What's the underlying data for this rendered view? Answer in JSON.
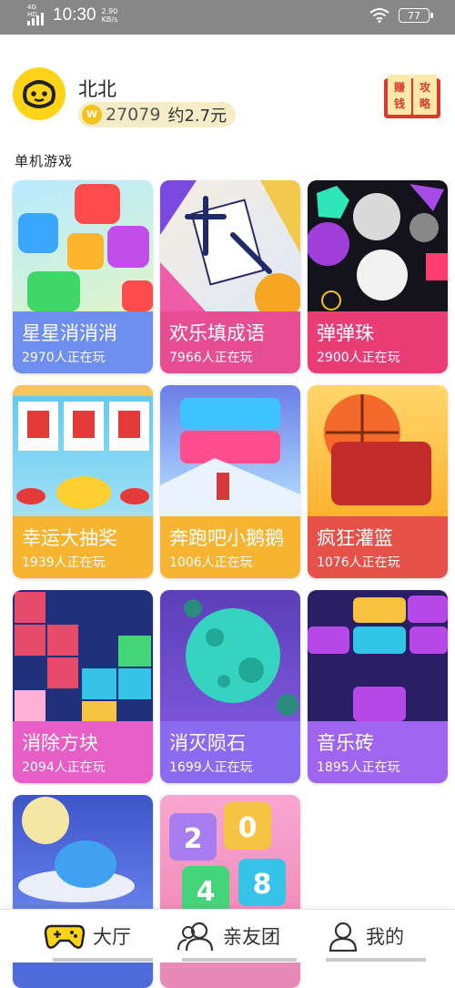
{
  "status_bar": {
    "network": "4G HD",
    "time": "10:30",
    "speed_value": "2.90",
    "speed_unit": "KB/s",
    "battery": "77"
  },
  "profile": {
    "name": "北北",
    "coins": "27079",
    "yuan_estimate": "约2.7元",
    "coin_icon_glyph": "W",
    "guide_button": [
      "赚",
      "钱",
      "攻",
      "略"
    ]
  },
  "section_title": "单机游戏",
  "games": [
    {
      "name": "星星消消消",
      "players": "2970人正在玩",
      "color": "#6e8ef0"
    },
    {
      "name": "欢乐填成语",
      "players": "7966人正在玩",
      "color": "#e64d93"
    },
    {
      "name": "弹弹珠",
      "players": "2900人正在玩",
      "color": "#ea3d76"
    },
    {
      "name": "幸运大抽奖",
      "players": "1939人正在玩",
      "color": "#f6b431"
    },
    {
      "name": "奔跑吧小鹅鹅",
      "players": "1006人正在玩",
      "color": "#f6b431"
    },
    {
      "name": "疯狂灌篮",
      "players": "1076人正在玩",
      "color": "#e8504a"
    },
    {
      "name": "消除方块",
      "players": "2094人正在玩",
      "color": "#e75ec7"
    },
    {
      "name": "消灭陨石",
      "players": "1699人正在玩",
      "color": "#8b6cf0"
    },
    {
      "name": "音乐砖",
      "players": "1895人正在玩",
      "color": "#a065ee"
    },
    {
      "name": "",
      "players": "",
      "color": "#4e6bd9"
    },
    {
      "name": "",
      "players": "",
      "color": "#e88ab7"
    }
  ],
  "game_2048_tiles": [
    "2",
    "0",
    "4",
    "8"
  ],
  "tabs": [
    {
      "label": "大厅",
      "icon": "gamepad-icon",
      "active": true
    },
    {
      "label": "亲友团",
      "icon": "friends-icon",
      "active": false
    },
    {
      "label": "我的",
      "icon": "person-icon",
      "active": false
    }
  ]
}
